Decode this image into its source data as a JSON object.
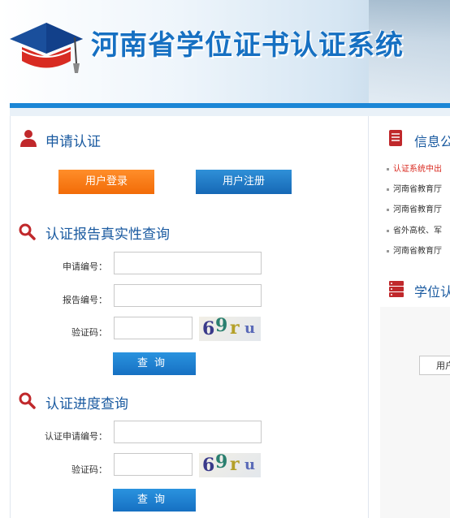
{
  "header": {
    "title": "河南省学位证书认证系统"
  },
  "apply": {
    "title": "申请认证",
    "login_label": "用户登录",
    "register_label": "用户注册"
  },
  "report_query": {
    "title": "认证报告真实性查询",
    "application_no_label": "申请编号：",
    "report_no_label": "报告编号：",
    "captcha_label": "验证码：",
    "captcha_text": "69ru",
    "query_label": "查询"
  },
  "progress_query": {
    "title": "认证进度查询",
    "application_no_label": "认证申请编号：",
    "captcha_label": "验证码：",
    "captcha_text": "69ru",
    "query_label": "查询"
  },
  "right": {
    "info_title": "信息公",
    "news": [
      {
        "text": "认证系统中出",
        "color": "#d9281e"
      },
      {
        "text": "河南省教育厅",
        "color": "#333333"
      },
      {
        "text": "河南省教育厅",
        "color": "#333333"
      },
      {
        "text": "省外高校、军",
        "color": "#333333"
      },
      {
        "text": "河南省教育厅",
        "color": "#333333"
      }
    ],
    "degree_title": "学位认",
    "button_label": "用户"
  },
  "colors": {
    "accent_blue": "#1670c2",
    "orange": "#f26b07",
    "title_red_icon": "#c0282b"
  }
}
